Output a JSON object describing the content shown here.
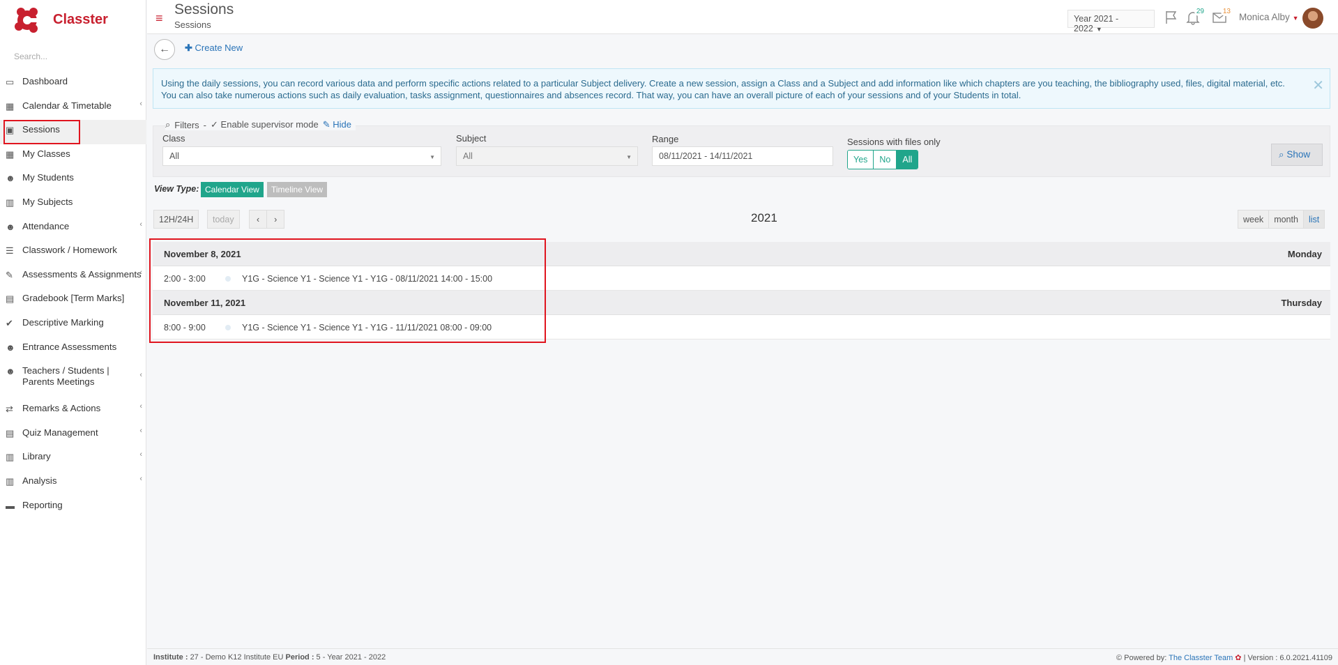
{
  "app": {
    "brand": "Classter"
  },
  "sidebar": {
    "search_placeholder": "Search...",
    "items": [
      {
        "label": "Dashboard",
        "icon": "laptop-icon",
        "has_submenu": false
      },
      {
        "label": "Calendar & Timetable",
        "icon": "calendar-icon",
        "has_submenu": true
      },
      {
        "label": "Sessions",
        "icon": "sessions-icon",
        "has_submenu": false,
        "active": true
      },
      {
        "label": "My Classes",
        "icon": "classes-icon",
        "has_submenu": false
      },
      {
        "label": "My Students",
        "icon": "students-icon",
        "has_submenu": false
      },
      {
        "label": "My Subjects",
        "icon": "book-icon",
        "has_submenu": false
      },
      {
        "label": "Attendance",
        "icon": "attendance-icon",
        "has_submenu": true
      },
      {
        "label": "Classwork / Homework",
        "icon": "list-icon",
        "has_submenu": false
      },
      {
        "label": "Assessments & Assignments",
        "icon": "edit-icon",
        "has_submenu": true
      },
      {
        "label": "Gradebook [Term Marks]",
        "icon": "gradebook-icon",
        "has_submenu": false
      },
      {
        "label": "Descriptive Marking",
        "icon": "marking-icon",
        "has_submenu": false
      },
      {
        "label": "Entrance Assessments",
        "icon": "user-edit-icon",
        "has_submenu": false
      },
      {
        "label": "Teachers / Students | Parents Meetings",
        "icon": "meeting-icon",
        "has_submenu": true
      },
      {
        "label": "Remarks & Actions",
        "icon": "shuffle-icon",
        "has_submenu": true
      },
      {
        "label": "Quiz Management",
        "icon": "quiz-icon",
        "has_submenu": true
      },
      {
        "label": "Library",
        "icon": "library-icon",
        "has_submenu": true
      },
      {
        "label": "Analysis",
        "icon": "analysis-icon",
        "has_submenu": true
      },
      {
        "label": "Reporting",
        "icon": "printer-icon",
        "has_submenu": false
      }
    ]
  },
  "header": {
    "title": "Sessions",
    "subtitle": "Sessions",
    "year_select": "Year 2021 - 2022",
    "notifications_count": "29",
    "messages_count": "13",
    "user_name": "Monica Alby"
  },
  "toolbar": {
    "create_new": "Create New"
  },
  "info": {
    "text": "Using the daily sessions, you can record various data and perform specific actions related to a particular Subject delivery. Create a new session, assign a Class and a Subject and add information like which chapters are you teaching, the bibliography used, files, digital material, etc. You can also take numerous actions such as daily evaluation, tasks assignment, questionnaires and absences record. That way, you can have an overall picture of each of your sessions and of your Students in total."
  },
  "filters": {
    "title": "Filters",
    "sep": "-",
    "supervisor": "Enable supervisor mode",
    "hide": "Hide",
    "class_label": "Class",
    "class_value": "All",
    "subject_label": "Subject",
    "subject_value": "All",
    "range_label": "Range",
    "range_value": "08/11/2021 - 14/11/2021",
    "files_label": "Sessions with files only",
    "files_options": [
      "Yes",
      "No",
      "All"
    ],
    "files_selected": "All",
    "show": "Show"
  },
  "view_type": {
    "label": "View Type:",
    "calendar": "Calendar View",
    "timeline": "Timeline View",
    "active_color": "#20a58b",
    "inactive_color": "#bdbdbd"
  },
  "calendar": {
    "hours_toggle": "12H/24H",
    "today": "today",
    "prev": "‹",
    "next": "›",
    "title": "2021",
    "views": [
      "week",
      "month",
      "list"
    ],
    "active_view": "list"
  },
  "sessions": [
    {
      "date": "November 8, 2021",
      "weekday": "Monday",
      "time": "2:00 - 3:00",
      "name": "Y1G - Science Y1 - Science Y1 - Y1G - 08/11/2021 14:00 - 15:00"
    },
    {
      "date": "November 11, 2021",
      "weekday": "Thursday",
      "time": "8:00 - 9:00",
      "name": "Y1G - Science Y1 - Science Y1 - Y1G - 11/11/2021 08:00 - 09:00"
    }
  ],
  "footer": {
    "institute_label": "Institute :",
    "institute_value": "27 - Demo K12 Institute EU",
    "period_label": "Period :",
    "period_value": "5 - Year 2021 - 2022",
    "powered_label": "Powered by:",
    "powered_link": "The Classter Team",
    "version": "| Version : 6.0.2021.41109"
  },
  "colors": {
    "brand": "#c8202f",
    "accent": "#20a58b",
    "link": "#2a74b8",
    "highlight": "#e0141e"
  }
}
